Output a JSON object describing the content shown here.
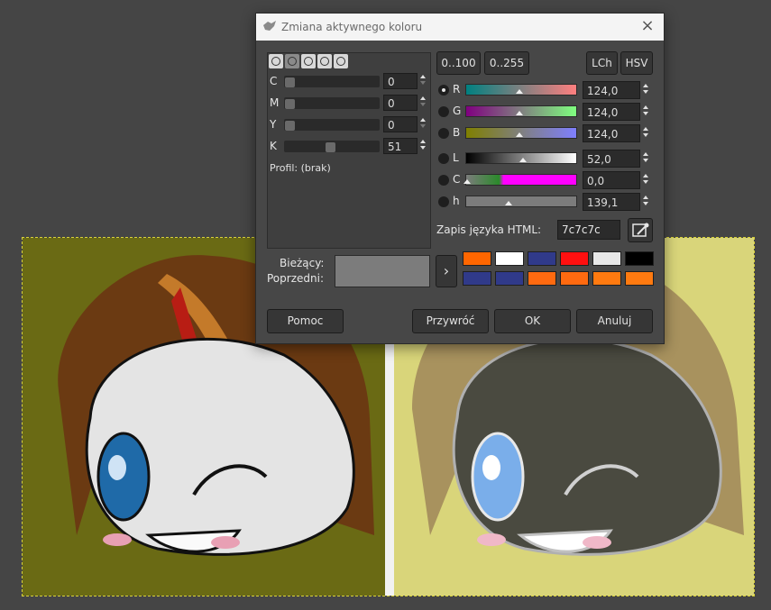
{
  "dialog": {
    "title": "Zmiana aktywnego koloru",
    "close_glyph": "×",
    "range_buttons": [
      "0..100",
      "0..255"
    ],
    "mode_buttons": [
      "LCh",
      "HSV"
    ],
    "cmyk": [
      {
        "label": "C",
        "value": "0",
        "level": 0
      },
      {
        "label": "M",
        "value": "0",
        "level": 0
      },
      {
        "label": "Y",
        "value": "0",
        "level": 0
      },
      {
        "label": "K",
        "value": "51",
        "level": 51
      }
    ],
    "profile_text": "Profil: (brak)",
    "sliders": [
      {
        "label": "R",
        "value": "124,0",
        "selected": true,
        "marker": 0.486
      },
      {
        "label": "G",
        "value": "124,0",
        "selected": false,
        "marker": 0.486
      },
      {
        "label": "B",
        "value": "124,0",
        "selected": false,
        "marker": 0.486
      },
      {
        "label": "L",
        "value": "52,0",
        "selected": false,
        "marker": 0.52
      },
      {
        "label": "C",
        "value": "0,0",
        "selected": false,
        "marker": 0.0
      },
      {
        "label": "h",
        "value": "139,1",
        "selected": false,
        "marker": 0.386
      }
    ],
    "html_label": "Zapis języka HTML:",
    "html_value": "7c7c7c",
    "current_label": "Bieżący:",
    "previous_label": "Poprzedni:",
    "current_color": "#7c7c7c",
    "previous_color": "#7c7c7c",
    "arrow_glyph": "›",
    "history_colors": [
      "#ff6600",
      "#ffffff",
      "#303a8a",
      "#ff1010",
      "#e8e8e8",
      "#000000",
      "#303a8a",
      "#303a8a",
      "#ff6a10",
      "#ff6a10",
      "#ff7a10",
      "#ff7a10"
    ],
    "buttons": {
      "help": "Pomoc",
      "reset": "Przywróć",
      "ok": "OK",
      "cancel": "Anuluj"
    }
  },
  "colors": {
    "dialog_bg": "#474747",
    "canvas_left_bg": "#6a6a14",
    "canvas_right_bg": "#d9d57a",
    "selection_border": "#d8d23a"
  }
}
